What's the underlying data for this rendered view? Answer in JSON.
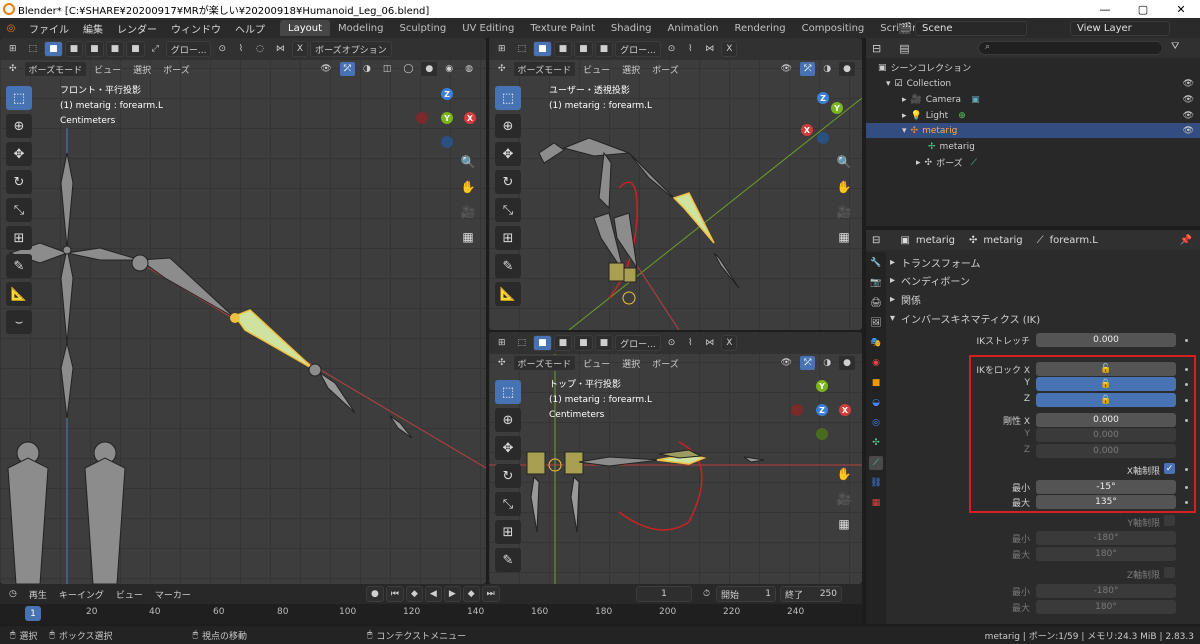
{
  "window": {
    "title": "Blender* [C:¥SHARE¥20200917¥MRが楽しい¥20200918¥Humanoid_Leg_06.blend]",
    "minimize": "—",
    "maximize": "▢",
    "close": "✕"
  },
  "menu": [
    "ファイル",
    "編集",
    "レンダー",
    "ウィンドウ",
    "ヘルプ"
  ],
  "workspaces": [
    "Layout",
    "Modeling",
    "Sculpting",
    "UV Editing",
    "Texture Paint",
    "Shading",
    "Animation",
    "Rendering",
    "Compositing",
    "Scripting"
  ],
  "workspace_add": "+",
  "scene": "Scene",
  "view_layer": "View Layer",
  "viewport_header": {
    "global": "グロー...",
    "x_mirror": "X",
    "options": "ボーズオプション",
    "mode": "ボーズモード",
    "menus": [
      "ビュー",
      "選択",
      "ボーズ"
    ]
  },
  "viewport_front": {
    "title": "フロント・平行投影",
    "object": "(1) metarig : forearm.L",
    "units": "Centimeters"
  },
  "viewport_user": {
    "title": "ユーザー・透視投影",
    "object": "(1) metarig : forearm.L"
  },
  "viewport_top": {
    "title": "トップ・平行投影",
    "object": "(1) metarig : forearm.L",
    "units": "Centimeters"
  },
  "gizmo": {
    "z": "Z",
    "y": "Y",
    "x": "X"
  },
  "outliner": {
    "root": "シーンコレクション",
    "items": [
      {
        "label": "Collection"
      },
      {
        "label": "Camera"
      },
      {
        "label": "Light"
      },
      {
        "label": "metarig"
      },
      {
        "label": "metarig"
      },
      {
        "label": "ボーズ"
      }
    ]
  },
  "properties": {
    "breadcrumb": [
      "metarig",
      "metarig",
      "forearm.L"
    ],
    "sections": [
      "トランスフォーム",
      "ベンディボーン",
      "関係",
      "インバースキネマティクス (IK)"
    ],
    "ik_stretch_label": "IKストレッチ",
    "ik_stretch_value": "0.000",
    "lock_label": "IKをロック X",
    "lock_y": "Y",
    "lock_z": "Z",
    "stiff_label": "剛性 X",
    "stiff_x": "0.000",
    "stiff_y_label": "Y",
    "stiff_y": "0.000",
    "stiff_z_label": "Z",
    "stiff_z": "0.000",
    "xlimit_label": "X軸制限",
    "min_label": "最小",
    "max_label": "最大",
    "x_min": "-15°",
    "x_max": "135°",
    "ylimit_label": "Y軸制限",
    "y_min": "-180°",
    "y_max": "180°",
    "zlimit_label": "Z軸制限",
    "z_min": "-180°",
    "z_max": "180°",
    "lock_icon": "🔒"
  },
  "timeline": {
    "menus": [
      "再生",
      "キーイング",
      "ビュー",
      "マーカー"
    ],
    "current_frame": "1",
    "start_label": "開始",
    "start": "1",
    "end_label": "終了",
    "end": "250",
    "ticks": [
      "1",
      "20",
      "40",
      "60",
      "80",
      "100",
      "120",
      "140",
      "160",
      "180",
      "200",
      "220",
      "240"
    ]
  },
  "status": {
    "select": "選択",
    "box_select": "ボックス選択",
    "rotate_view": "視点の移動",
    "context_menu": "コンテクストメニュー",
    "info": "metarig | ボーン:1/59 | メモリ:24.3 MiB | 2.83.3"
  },
  "colors": {
    "accent": "#4772b3",
    "highlight_box": "#d42020",
    "x_axis": "#d63b3b",
    "y_axis": "#7ab51d",
    "z_axis": "#3b7fd6"
  }
}
